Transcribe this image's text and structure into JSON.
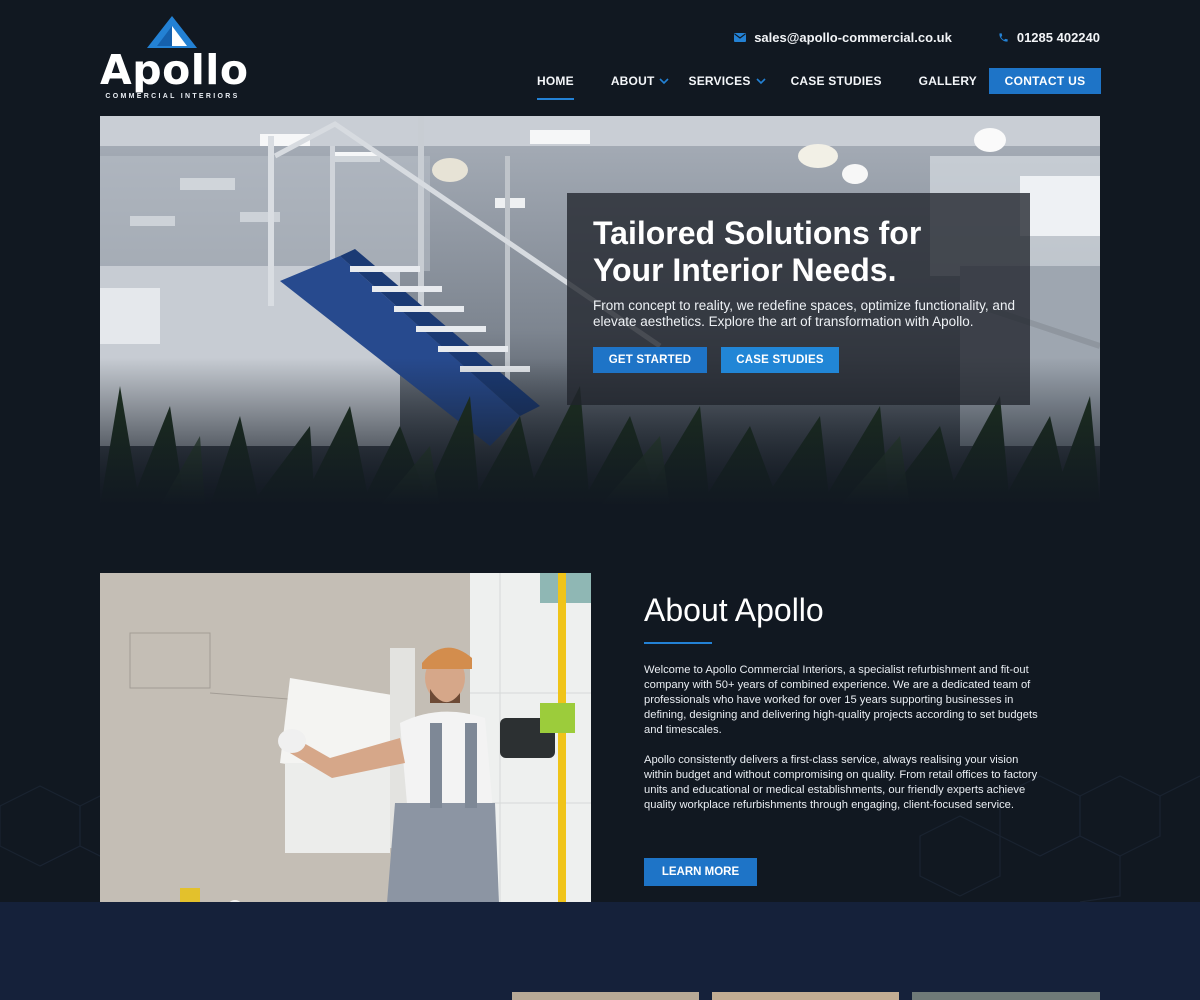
{
  "brand": {
    "name": "Apollo",
    "tagline": "COMMERCIAL INTERIORS",
    "accent": "#1e74c7",
    "background": "#111821"
  },
  "contact": {
    "email": "sales@apollo-commercial.co.uk",
    "phone": "01285 402240"
  },
  "nav": {
    "items": [
      {
        "label": "HOME",
        "active": true
      },
      {
        "label": "ABOUT",
        "dropdown": true
      },
      {
        "label": "SERVICES",
        "dropdown": true
      },
      {
        "label": "CASE STUDIES"
      },
      {
        "label": "GALLERY"
      }
    ],
    "cta": "CONTACT US"
  },
  "hero": {
    "title_line1": "Tailored Solutions for",
    "title_line2": "Your Interior Needs.",
    "subtitle": "From concept to reality, we redefine spaces, optimize functionality, and elevate aesthetics. Explore the art of transformation with Apollo.",
    "btn_primary": "GET STARTED",
    "btn_secondary": "CASE STUDIES"
  },
  "about": {
    "heading": "About Apollo",
    "para1": "Welcome to Apollo Commercial Interiors, a specialist refurbishment and fit-out company with 50+ years of combined experience. We are a dedicated team of professionals who have worked for over 15 years supporting businesses in defining, designing and delivering high-quality projects according to set budgets and timescales.",
    "para2": "Apollo consistently delivers a first-class service, always realising your vision within budget and without compromising on quality. From retail offices to factory units and educational or medical establishments, our friendly experts achieve quality workplace refurbishments through engaging, client-focused service.",
    "button": "LEARN MORE"
  },
  "icons": {
    "email": "envelope-icon",
    "phone": "phone-icon",
    "dropdown": "chevron-down-icon"
  }
}
